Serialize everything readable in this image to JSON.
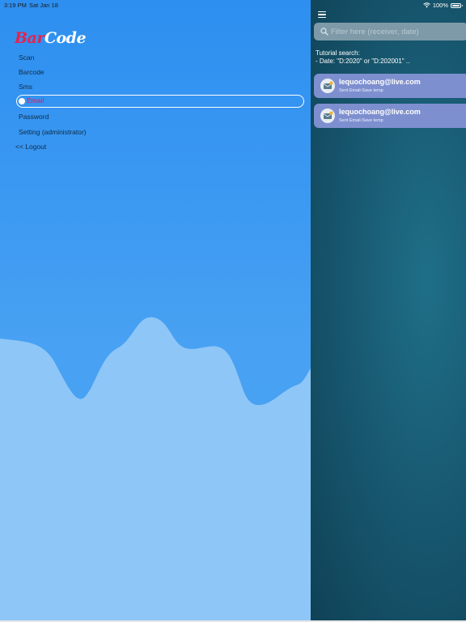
{
  "status_bar": {
    "time": "3:19 PM",
    "date": "Sat Jan 18",
    "battery": "100%",
    "icons": [
      "wifi-icon",
      "battery-icon"
    ]
  },
  "logo": {
    "part1": "Bar",
    "part2": "Code"
  },
  "menu": {
    "items": [
      {
        "label": "Scan"
      },
      {
        "label": "Barcode"
      },
      {
        "label": "Sms"
      },
      {
        "label": "Email",
        "active": true
      },
      {
        "label": "Password"
      },
      {
        "label": "Setting (administrator)"
      }
    ],
    "logout": "<< Logout"
  },
  "search": {
    "placeholder": "Filter here (receiver, date)",
    "value": ""
  },
  "tutorial": {
    "line1": "Tutorial search:",
    "line2": "- Date: \"D:2020\" or \"D:202001\" .."
  },
  "list": {
    "items": [
      {
        "email": "lequochoang@live.com",
        "status": "Sent Email-Save temp"
      },
      {
        "email": "lequochoang@live.com",
        "status": "Sent Email-Save temp"
      }
    ]
  },
  "colors": {
    "menu_bg": "#2d8ff0",
    "wave_light": "#8ec6f7",
    "content_bg": "#185a72",
    "list_item": "#7e8fcf",
    "active_text": "#d81b60",
    "logo_red": "#e8214a"
  }
}
